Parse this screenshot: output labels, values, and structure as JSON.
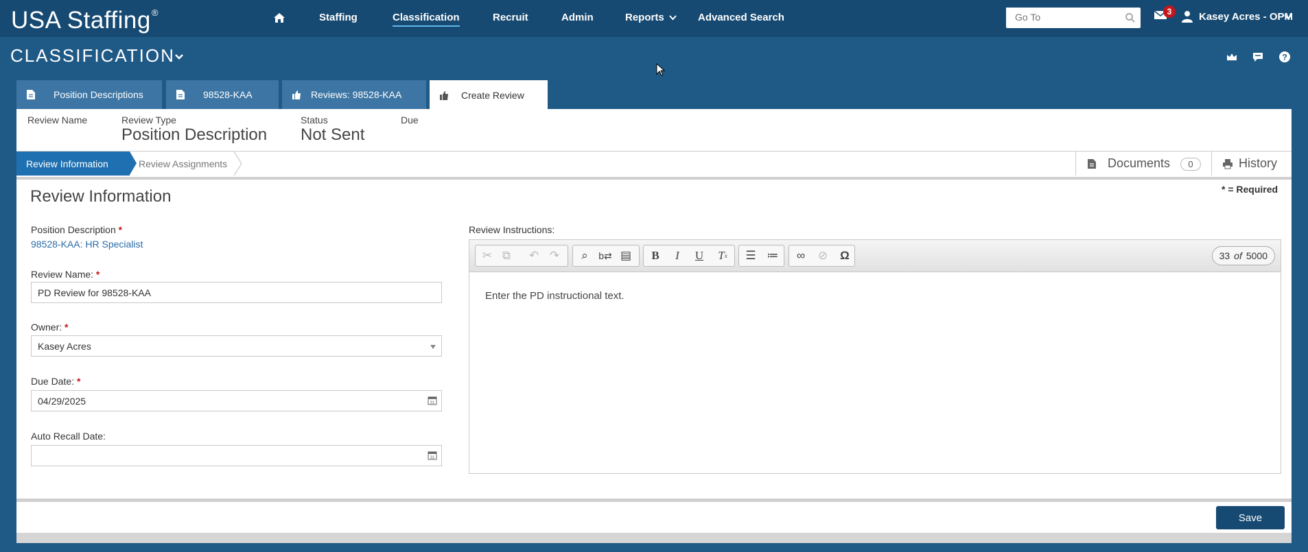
{
  "nav": {
    "logo": "USA Staffing",
    "logo_mark": "®",
    "items": [
      "Staffing",
      "Classification",
      "Recruit",
      "Admin",
      "Reports",
      "Advanced Search"
    ],
    "goto_placeholder": "Go To",
    "mail_count": "3",
    "user": "Kasey Acres - OPM"
  },
  "header": {
    "title": "CLASSIFICATION"
  },
  "tabs": [
    {
      "label": "Position Descriptions",
      "icon": "document-icon"
    },
    {
      "label": "98528-KAA",
      "icon": "document-icon"
    },
    {
      "label": "Reviews: 98528-KAA",
      "icon": "thumbs-up-icon"
    },
    {
      "label": "Create Review",
      "icon": "thumbs-up-icon"
    }
  ],
  "meta": {
    "review_name_label": "Review Name",
    "review_type_label": "Review Type",
    "review_type_value": "Position Description",
    "status_label": "Status",
    "status_value": "Not Sent",
    "due_label": "Due"
  },
  "steps": {
    "step1": "Review Information",
    "step2": "Review Assignments"
  },
  "side": {
    "documents": "Documents",
    "documents_count": "0",
    "history": "History"
  },
  "form": {
    "section_title": "Review Information",
    "required_note": "* = Required",
    "pd_label": "Position Description",
    "pd_value": "98528-KAA: HR Specialist",
    "review_name_label": "Review Name:",
    "review_name_value": "PD Review for 98528-KAA",
    "owner_label": "Owner:",
    "owner_value": "Kasey Acres",
    "due_label": "Due Date:",
    "due_value": "04/29/2025",
    "recall_label": "Auto Recall Date:",
    "recall_value": "",
    "instructions_label": "Review Instructions:",
    "instructions_text": "Enter the PD instructional text.",
    "char_count": "33",
    "char_of": "of",
    "char_max": "5000",
    "req_star": "*"
  },
  "save_label": "Save",
  "colors": {
    "nav_bg": "#174a72",
    "page_bg": "#1f5a87",
    "active_step": "#1f70b0",
    "badge": "#c4161c"
  }
}
